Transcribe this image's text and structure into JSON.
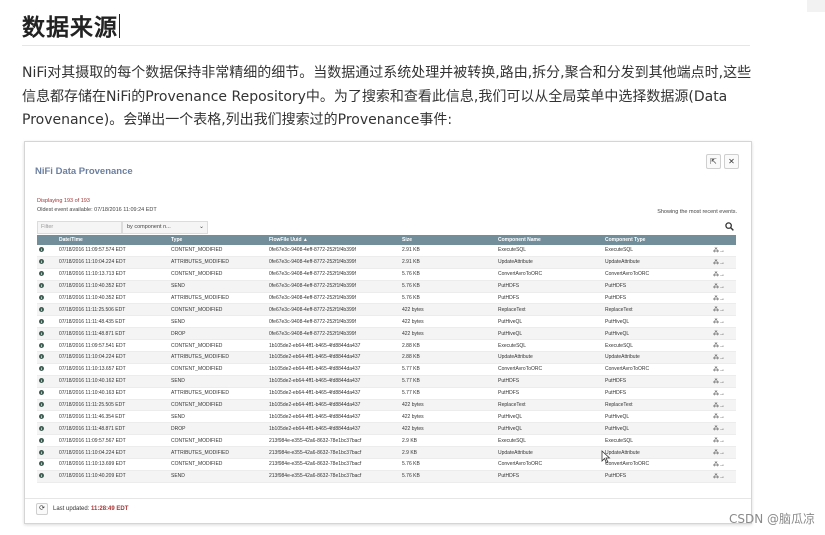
{
  "article": {
    "title": "数据来源",
    "paragraph": "NiFi对其摄取的每个数据保持非常精细的细节。当数据通过系统处理并被转换,路由,拆分,聚合和分发到其他端点时,这些信息都存储在NiFi的Provenance Repository中。为了搜索和查看此信息,我们可以从全局菜单中选择数据源(Data Provenance)。会弹出一个表格,列出我们搜索过的Provenance事件:"
  },
  "dialog": {
    "title": "NiFi Data Provenance",
    "displaying": "Displaying 193 of 193",
    "oldest_event": "Oldest event available: 07/18/2016 11:09:24 EDT",
    "recent_note": "Showing the most recent events.",
    "filter_placeholder": "Filter",
    "filter_by": "by component n...",
    "last_updated_label": "Last updated:",
    "last_updated_time": "11:28:49 EDT"
  },
  "table": {
    "columns": [
      "",
      "Date/Time",
      "Type",
      "FlowFile Uuid ▲",
      "Size",
      "Component Name",
      "Component Type",
      ""
    ],
    "rows": [
      [
        "07/18/2016 11:09:57.574 EDT",
        "CONTENT_MODIFIED",
        "0fe67e3c-9408-4eff-8772-252f1f4b399f",
        "2.91 KB",
        "ExecuteSQL",
        "ExecuteSQL"
      ],
      [
        "07/18/2016 11:10:04.224 EDT",
        "ATTRIBUTES_MODIFIED",
        "0fe67e3c-9408-4eff-8772-252f1f4b399f",
        "2.91 KB",
        "UpdateAttribute",
        "UpdateAttribute"
      ],
      [
        "07/18/2016 11:10:13.713 EDT",
        "CONTENT_MODIFIED",
        "0fe67e3c-9408-4eff-8772-252f1f4b399f",
        "5.76 KB",
        "ConvertAvroToORC",
        "ConvertAvroToORC"
      ],
      [
        "07/18/2016 11:10:40.352 EDT",
        "SEND",
        "0fe67e3c-9408-4eff-8772-252f1f4b399f",
        "5.76 KB",
        "PutHDFS",
        "PutHDFS"
      ],
      [
        "07/18/2016 11:10:40.352 EDT",
        "ATTRIBUTES_MODIFIED",
        "0fe67e3c-9408-4eff-8772-252f1f4b399f",
        "5.76 KB",
        "PutHDFS",
        "PutHDFS"
      ],
      [
        "07/18/2016 11:11:25.506 EDT",
        "CONTENT_MODIFIED",
        "0fe67e3c-9408-4eff-8772-252f1f4b399f",
        "422 bytes",
        "ReplaceText",
        "ReplaceText"
      ],
      [
        "07/18/2016 11:11:48.435 EDT",
        "SEND",
        "0fe67e3c-9408-4eff-8772-252f1f4b399f",
        "422 bytes",
        "PutHiveQL",
        "PutHiveQL"
      ],
      [
        "07/18/2016 11:11:48.871 EDT",
        "DROP",
        "0fe67e3c-9408-4eff-8772-252f1f4b399f",
        "422 bytes",
        "PutHiveQL",
        "PutHiveQL"
      ],
      [
        "07/18/2016 11:09:57.541 EDT",
        "CONTENT_MODIFIED",
        "1b105de2-eb64-4ff1-b465-4fd8844da437",
        "2.88 KB",
        "ExecuteSQL",
        "ExecuteSQL"
      ],
      [
        "07/18/2016 11:10:04.224 EDT",
        "ATTRIBUTES_MODIFIED",
        "1b105de2-eb64-4ff1-b465-4fd8844da437",
        "2.88 KB",
        "UpdateAttribute",
        "UpdateAttribute"
      ],
      [
        "07/18/2016 11:10:13.657 EDT",
        "CONTENT_MODIFIED",
        "1b105de2-eb64-4ff1-b465-4fd8844da437",
        "5.77 KB",
        "ConvertAvroToORC",
        "ConvertAvroToORC"
      ],
      [
        "07/18/2016 11:10:40.162 EDT",
        "SEND",
        "1b105de2-eb64-4ff1-b465-4fd8844da437",
        "5.77 KB",
        "PutHDFS",
        "PutHDFS"
      ],
      [
        "07/18/2016 11:10:40.163 EDT",
        "ATTRIBUTES_MODIFIED",
        "1b105de2-eb64-4ff1-b465-4fd8844da437",
        "5.77 KB",
        "PutHDFS",
        "PutHDFS"
      ],
      [
        "07/18/2016 11:11:25.505 EDT",
        "CONTENT_MODIFIED",
        "1b105de2-eb64-4ff1-b465-4fd8844da437",
        "422 bytes",
        "ReplaceText",
        "ReplaceText"
      ],
      [
        "07/18/2016 11:11:46.354 EDT",
        "SEND",
        "1b105de2-eb64-4ff1-b465-4fd8844da437",
        "422 bytes",
        "PutHiveQL",
        "PutHiveQL"
      ],
      [
        "07/18/2016 11:11:48.871 EDT",
        "DROP",
        "1b105de2-eb64-4ff1-b465-4fd8844da437",
        "422 bytes",
        "PutHiveQL",
        "PutHiveQL"
      ],
      [
        "07/18/2016 11:09:57.567 EDT",
        "CONTENT_MODIFIED",
        "213f984e-e355-42a6-8632-78e1bc37bacf",
        "2.9 KB",
        "ExecuteSQL",
        "ExecuteSQL"
      ],
      [
        "07/18/2016 11:10:04.224 EDT",
        "ATTRIBUTES_MODIFIED",
        "213f984e-e355-42a6-8632-78e1bc37bacf",
        "2.9 KB",
        "UpdateAttribute",
        "UpdateAttribute"
      ],
      [
        "07/18/2016 11:10:13.699 EDT",
        "CONTENT_MODIFIED",
        "213f984e-e355-42a6-8632-78e1bc37bacf",
        "5.76 KB",
        "ConvertAvroToORC",
        "ConvertAvroToORC"
      ],
      [
        "07/18/2016 11:10:40.209 EDT",
        "SEND",
        "213f984e-e355-42a6-8632-78e1bc37bacf",
        "5.76 KB",
        "PutHDFS",
        "PutHDFS"
      ]
    ]
  },
  "watermark": "CSDN @脑瓜凉",
  "colors": {
    "header": "#728e9b",
    "title": "#6b7fa0",
    "count": "#a83434"
  },
  "icons": [
    "info-icon",
    "lineage-icon",
    "search-icon",
    "close-icon",
    "popout-icon",
    "refresh-icon",
    "chevron-down-icon",
    "mouse-cursor-icon"
  ]
}
